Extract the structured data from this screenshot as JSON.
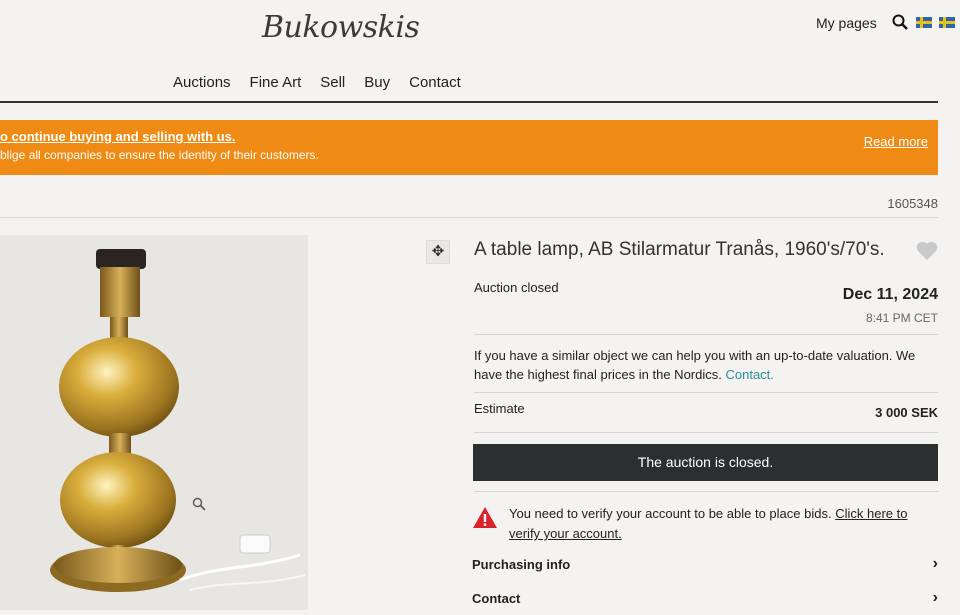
{
  "header": {
    "logo": "Bukowskis",
    "my_pages": "My pages"
  },
  "nav": [
    "Auctions",
    "Fine Art",
    "Sell",
    "Buy",
    "Contact"
  ],
  "banner": {
    "line1": "o continue buying and selling with us.",
    "line2": "blige all companies to ensure the identity of their customers.",
    "read_more": "Read more"
  },
  "lot": {
    "id": "1605348",
    "title": "A table lamp, AB Stilarmatur Tranås, 1960's/70's.",
    "status": "Auction closed",
    "date": "Dec 11, 2024",
    "time": "8:41 PM CET",
    "valuation_text": "If you have a similar object we can help you with an up-to-date valuation. We have the highest final prices in the Nordics.",
    "valuation_link": "Contact.",
    "estimate_label": "Estimate",
    "estimate_value": "3 000 SEK",
    "closed_button": "The auction is closed.",
    "verify_text": "You need to verify your account to be able to place bids.",
    "verify_link": "Click here to verify your account."
  },
  "sections": [
    "Purchasing info",
    "Contact"
  ],
  "colors": {
    "banner": "#ef8a14",
    "button": "#2b2f30",
    "link": "#2a8f9a",
    "warning": "#d9232a"
  }
}
